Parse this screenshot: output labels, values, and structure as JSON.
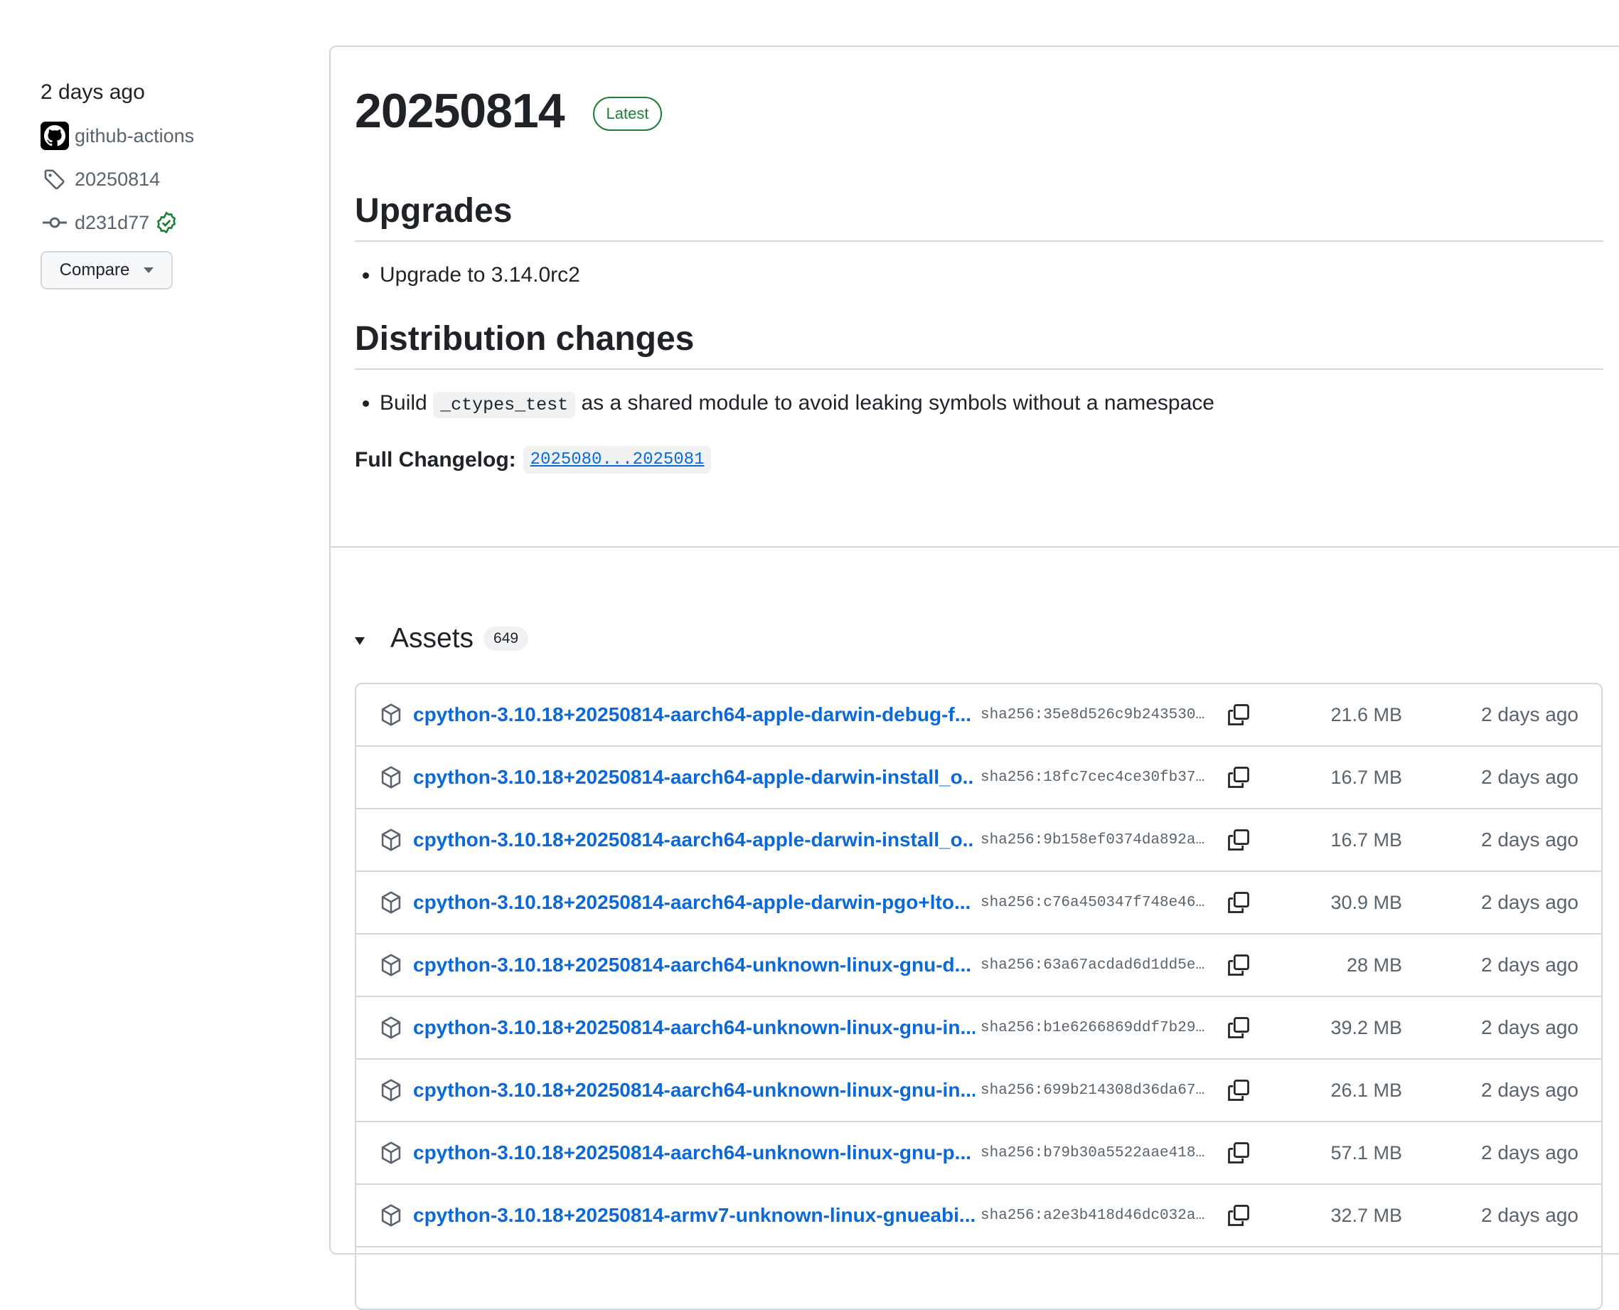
{
  "sidebar": {
    "date": "2 days ago",
    "author": "github-actions",
    "tag": "20250814",
    "commit": "d231d77",
    "compare_label": "Compare"
  },
  "release": {
    "title": "20250814",
    "badge": "Latest",
    "sections": [
      {
        "heading": "Upgrades"
      },
      {
        "heading": "Distribution changes"
      }
    ],
    "upgrade_item": "Upgrade to 3.14.0rc2",
    "dist_item": {
      "prefix": "Build",
      "code": "_ctypes_test",
      "suffix": "as a shared module to avoid leaking symbols without a namespace"
    },
    "changelog_label": "Full Changelog:",
    "changelog_link": "2025080...2025081"
  },
  "assets": {
    "title": "Assets",
    "count": "649",
    "rows": [
      {
        "name": "cpython-3.10.18+20250814-aarch64-apple-darwin-debug-f...",
        "sha": "sha256:35e8d526c9b243530…",
        "size": "21.6 MB",
        "date": "2 days ago"
      },
      {
        "name": "cpython-3.10.18+20250814-aarch64-apple-darwin-install_o...",
        "sha": "sha256:18fc7cec4ce30fb37…",
        "size": "16.7 MB",
        "date": "2 days ago"
      },
      {
        "name": "cpython-3.10.18+20250814-aarch64-apple-darwin-install_o...",
        "sha": "sha256:9b158ef0374da892a…",
        "size": "16.7 MB",
        "date": "2 days ago"
      },
      {
        "name": "cpython-3.10.18+20250814-aarch64-apple-darwin-pgo+lto...",
        "sha": "sha256:c76a450347f748e46…",
        "size": "30.9 MB",
        "date": "2 days ago"
      },
      {
        "name": "cpython-3.10.18+20250814-aarch64-unknown-linux-gnu-d...",
        "sha": "sha256:63a67acdad6d1dd5e…",
        "size": "28 MB",
        "date": "2 days ago"
      },
      {
        "name": "cpython-3.10.18+20250814-aarch64-unknown-linux-gnu-in...",
        "sha": "sha256:b1e6266869ddf7b29…",
        "size": "39.2 MB",
        "date": "2 days ago"
      },
      {
        "name": "cpython-3.10.18+20250814-aarch64-unknown-linux-gnu-in...",
        "sha": "sha256:699b214308d36da67…",
        "size": "26.1 MB",
        "date": "2 days ago"
      },
      {
        "name": "cpython-3.10.18+20250814-aarch64-unknown-linux-gnu-p...",
        "sha": "sha256:b79b30a5522aae418…",
        "size": "57.1 MB",
        "date": "2 days ago"
      },
      {
        "name": "cpython-3.10.18+20250814-armv7-unknown-linux-gnueabi...",
        "sha": "sha256:a2e3b418d46dc032a…",
        "size": "32.7 MB",
        "date": "2 days ago"
      },
      {
        "name": "",
        "sha": "",
        "size": "",
        "date": ""
      }
    ]
  },
  "icons": {
    "avatar": "github-mark-icon",
    "tag": "tag-icon",
    "commit": "git-commit-icon",
    "verified": "check-circle-icon",
    "asset": "package-icon",
    "copy": "copy-icon"
  },
  "colors": {
    "link": "#0969da",
    "success": "#1a7f37",
    "border": "#d1d9e0",
    "muted": "#59636e"
  }
}
